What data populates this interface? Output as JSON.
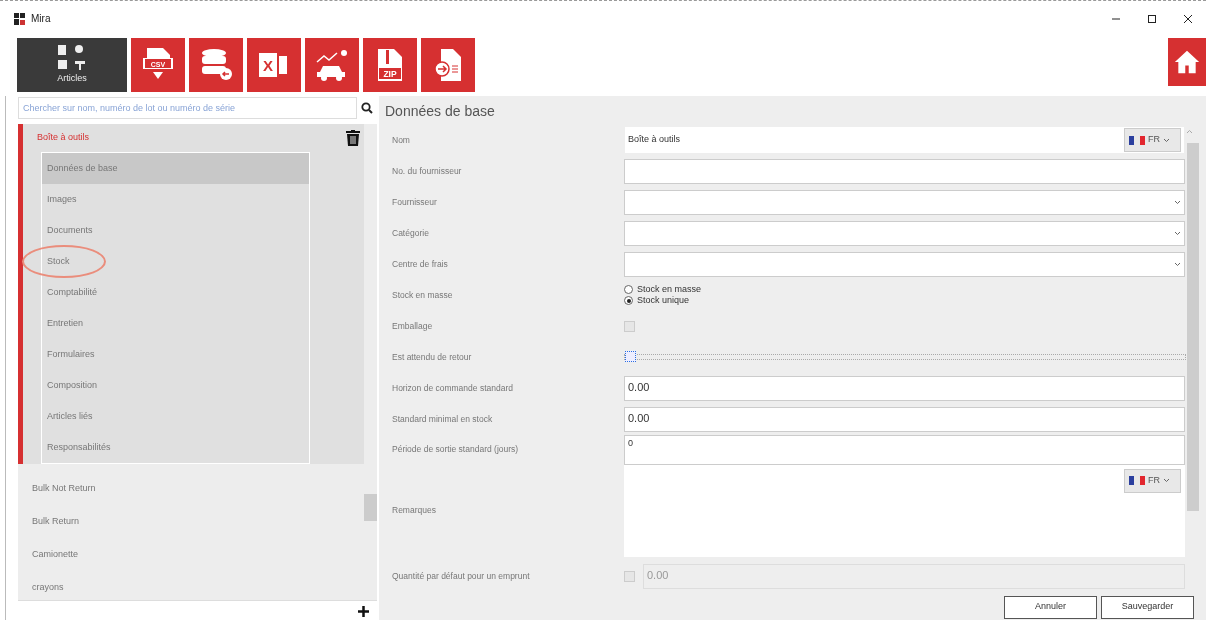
{
  "window": {
    "title": "Mira"
  },
  "toolbar": {
    "tiles": [
      {
        "kind": "articles",
        "label": "Articles",
        "selected": true
      },
      {
        "kind": "csv",
        "label": "CSV",
        "selected": false
      },
      {
        "kind": "database",
        "selected": false
      },
      {
        "kind": "excel",
        "label": "X",
        "selected": false
      },
      {
        "kind": "car",
        "selected": false
      },
      {
        "kind": "zip",
        "label": "ZIP",
        "selected": false
      },
      {
        "kind": "document",
        "selected": false
      }
    ]
  },
  "search": {
    "placeholder": "Chercher sur nom, numéro de lot ou numéro de série"
  },
  "tree": [
    {
      "label": "Boîte à outils",
      "expanded": true,
      "children": [
        {
          "label": "Données de base",
          "selected": true,
          "circled": false
        },
        {
          "label": "Images",
          "selected": false,
          "circled": false
        },
        {
          "label": "Documents",
          "selected": false,
          "circled": false
        },
        {
          "label": "Stock",
          "selected": false,
          "circled": true
        },
        {
          "label": "Comptabilité",
          "selected": false,
          "circled": false
        },
        {
          "label": "Entretien",
          "selected": false,
          "circled": false
        },
        {
          "label": "Formulaires",
          "selected": false,
          "circled": false
        },
        {
          "label": "Composition",
          "selected": false,
          "circled": false
        },
        {
          "label": "Articles liés",
          "selected": false,
          "circled": false
        },
        {
          "label": "Responsabilités",
          "selected": false,
          "circled": false
        }
      ]
    },
    {
      "label": "Bulk Not Return",
      "expanded": false
    },
    {
      "label": "Bulk Return",
      "expanded": false
    },
    {
      "label": "Camionette",
      "expanded": false
    },
    {
      "label": "crayons",
      "expanded": false
    }
  ],
  "form": {
    "title": "Données de base",
    "rows": [
      {
        "kind": "text",
        "label": "Nom",
        "value": "Boîte à outils",
        "language": "FR"
      },
      {
        "kind": "text",
        "label": "No. du fournisseur"
      },
      {
        "kind": "select",
        "label": "Fournisseur"
      },
      {
        "kind": "select",
        "label": "Catégorie"
      },
      {
        "kind": "select",
        "label": "Centre de frais"
      },
      {
        "kind": "radio",
        "label": "Stock en masse",
        "options": [
          {
            "label": "Stock en masse",
            "selected": false
          },
          {
            "label": "Stock unique",
            "selected": true
          }
        ]
      },
      {
        "kind": "checkbox",
        "label": "Emballage",
        "checked": false
      },
      {
        "kind": "focus-checkbox",
        "label": "Est attendu de retour",
        "checked": false
      },
      {
        "kind": "number",
        "label": "Horizon de commande standard",
        "value": "0.00"
      },
      {
        "kind": "number",
        "label": "Standard minimal en stock",
        "value": "0.00"
      },
      {
        "kind": "tall",
        "label": "Période de sortie standard (jours)",
        "value": "0"
      },
      {
        "kind": "textarea",
        "label": "Remarques",
        "language": "FR"
      },
      {
        "kind": "check-number",
        "label": "Quantité par défaut pour un emprunt",
        "checked": false,
        "value": "0.00",
        "disabled": true
      }
    ]
  },
  "buttons": [
    "Annuler",
    "Sauvegarder"
  ]
}
